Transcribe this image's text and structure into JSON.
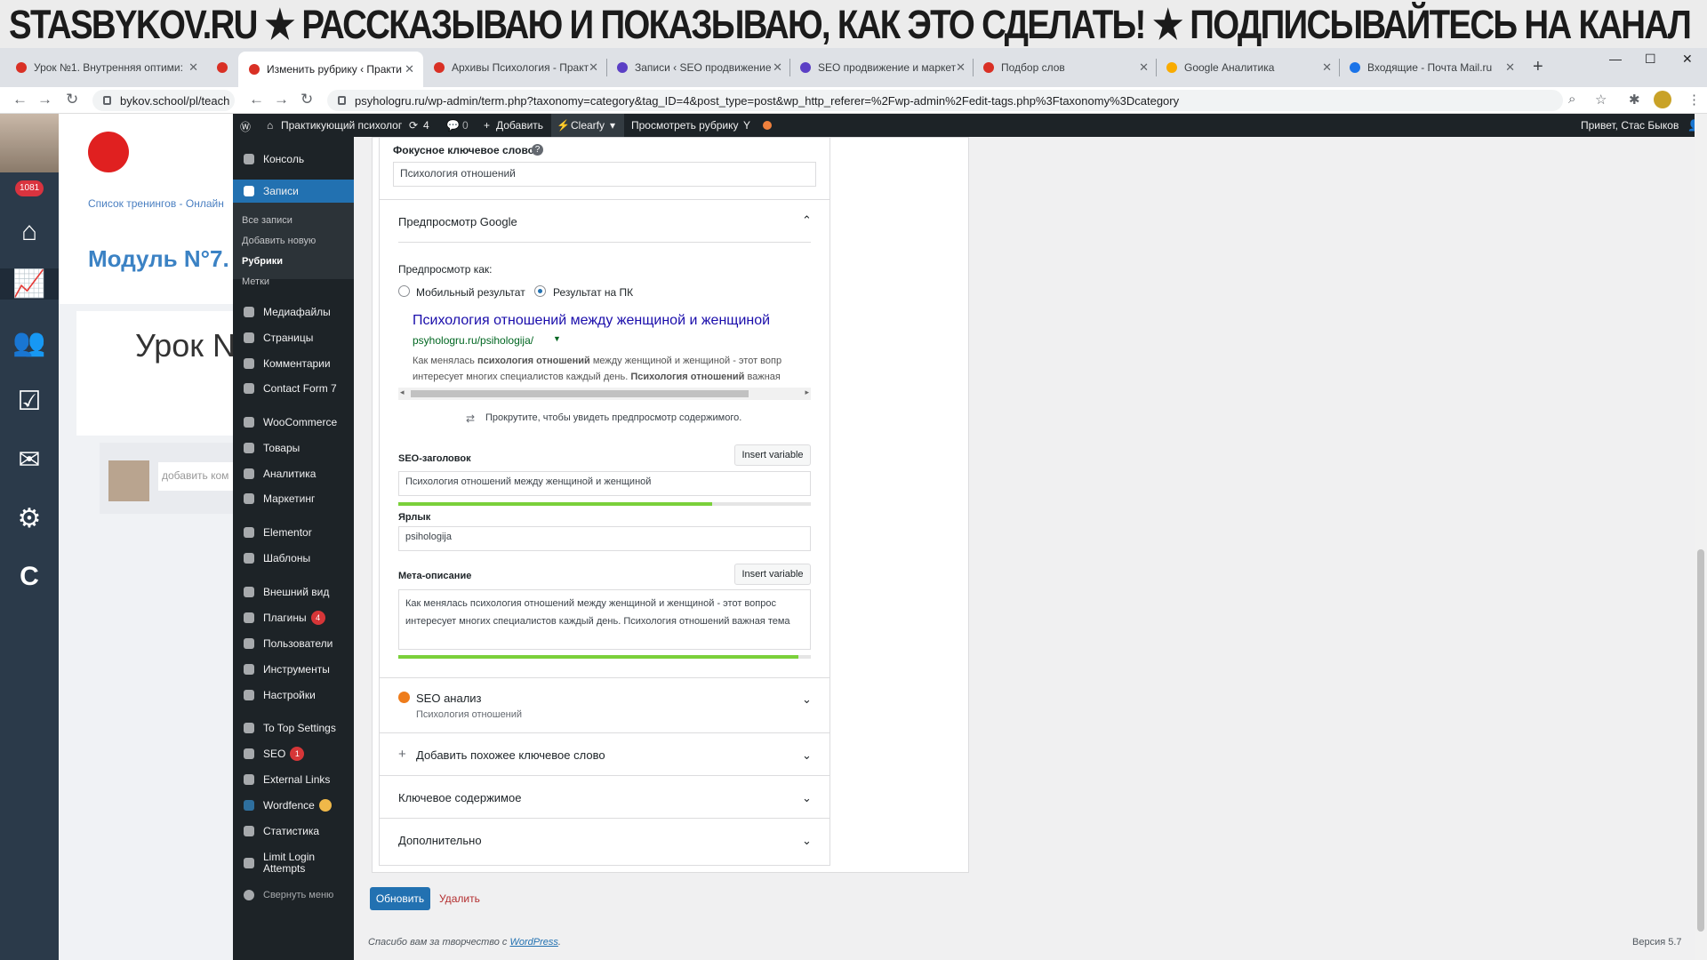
{
  "banner": {
    "text": "STASBYKOV.RU ★ РАССКАЗЫВАЮ И ПОКАЗЫВАЮ, КАК ЭТО СДЕЛАТЬ! ★ ПОДПИСЫВАЙТЕСЬ НА КАНАЛ"
  },
  "browser": {
    "tabs": [
      {
        "title": "Урок №1. Внутренняя оптими:",
        "color": "#d93025"
      },
      {
        "title": "Изменить рубрику ‹ Практи",
        "color": "#d93025"
      },
      {
        "title": "Архивы Психология - Практ",
        "color": "#d93025"
      },
      {
        "title": "Записи ‹ SEO продвижение",
        "color": "#5b3fc5"
      },
      {
        "title": "SEO продвижение и маркет",
        "color": "#5b3fc5"
      },
      {
        "title": "Подбор слов",
        "color": "#d93025"
      },
      {
        "title": "Google Аналитика",
        "color": "#f9ab00"
      },
      {
        "title": "Входящие - Почта Mail.ru",
        "color": "#1a73e8"
      }
    ],
    "new_tab": "+",
    "left_url": "bykov.school/pl/teach",
    "url": "psyhologru.ru/wp-admin/term.php?taxonomy=category&tag_ID=4&post_type=post&wp_http_referer=%2Fwp-admin%2Fedit-tags.php%3Ftaxonomy%3Dcategory"
  },
  "left_page": {
    "badge": "1081",
    "breadcrumb": "Список тренингов - Онлайн",
    "module_title": "Модуль N°7.",
    "lesson_title": "Урок N",
    "comment_placeholder": "добавить ком"
  },
  "admin_bar": {
    "site": "Практикующий психолог",
    "updates": "4",
    "comments": "0",
    "add": "Добавить",
    "clearfy": "Clearfy",
    "view": "Просмотреть рубрику",
    "greeting": "Привет, Стас Быков"
  },
  "menu": {
    "items": [
      {
        "label": "Консоль"
      },
      {
        "label": "Записи"
      },
      {
        "label": "Медиафайлы"
      },
      {
        "label": "Страницы"
      },
      {
        "label": "Комментарии"
      },
      {
        "label": "Contact Form 7"
      },
      {
        "label": "WooCommerce"
      },
      {
        "label": "Товары"
      },
      {
        "label": "Аналитика"
      },
      {
        "label": "Маркетинг"
      },
      {
        "label": "Elementor"
      },
      {
        "label": "Шаблоны"
      },
      {
        "label": "Внешний вид"
      },
      {
        "label": "Плагины",
        "badge": "4"
      },
      {
        "label": "Пользователи"
      },
      {
        "label": "Инструменты"
      },
      {
        "label": "Настройки"
      },
      {
        "label": "To Top Settings"
      },
      {
        "label": "SEO",
        "badge": "1"
      },
      {
        "label": "External Links"
      },
      {
        "label": "Wordfence"
      },
      {
        "label": "Статистика"
      },
      {
        "label": "Limit Login Attempts"
      },
      {
        "label": "Свернуть меню"
      }
    ],
    "sub": [
      "Все записи",
      "Добавить новую",
      "Рубрики",
      "Метки"
    ]
  },
  "seo": {
    "focus_label": "Фокусное ключевое слово",
    "focus_value": "Психология отношений",
    "google_preview": "Предпросмотр Google",
    "preview_as": "Предпросмотр как:",
    "mobile": "Мобильный результат",
    "desktop": "Результат на ПК",
    "serp_title": "Психология отношений между женщиной и женщиной",
    "serp_url": "psyhologru.ru/psihologija/",
    "serp_desc_1_pre": "Как менялась ",
    "serp_desc_1_bold": "психология отношений",
    "serp_desc_1_post": " между женщиной и женщиной - этот вопр",
    "serp_desc_2_pre": "интересует многих специалистов каждый день. ",
    "serp_desc_2_bold": "Психология отношений",
    "serp_desc_2_post": " важная",
    "scroll_hint": "Прокрутите, чтобы увидеть предпросмотр содержимого.",
    "title_label": "SEO-заголовок",
    "insert_var": "Insert variable",
    "title_value": "Психология отношений между женщиной и женщиной",
    "title_progress": 0.76,
    "slug_label": "Ярлык",
    "slug_value": "psihologija",
    "meta_label": "Мета-описание",
    "meta_value": "Как менялась психология отношений между женщиной и женщиной - этот вопрос интересует многих специалистов каждый день. Психология отношений важная тема",
    "meta_progress": 0.97,
    "analysis": "SEO анализ",
    "analysis_sub": "Психология отношений",
    "add_keyword": "Добавить похожее ключевое слово",
    "cornerstone": "Ключевое содержимое",
    "advanced": "Дополнительно"
  },
  "actions": {
    "update": "Обновить",
    "delete": "Удалить"
  },
  "footer": {
    "thanks": "Спасибо вам за творчество с ",
    "wp": "WordPress",
    "version": "Версия 5.7"
  }
}
